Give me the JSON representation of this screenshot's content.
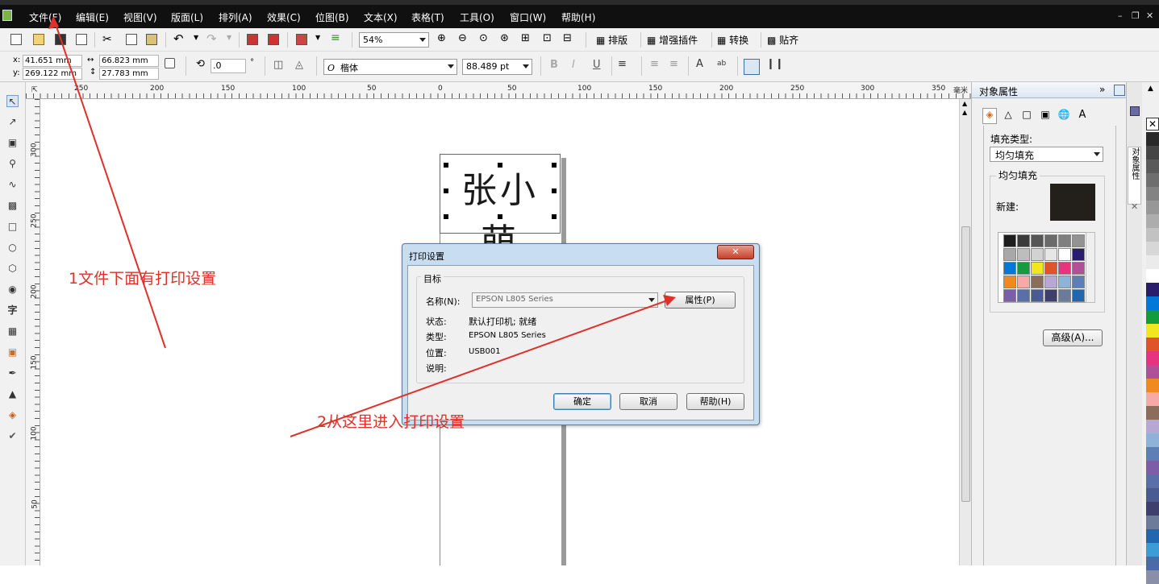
{
  "menu": {
    "items": [
      "文件(F)",
      "编辑(E)",
      "视图(V)",
      "版面(L)",
      "排列(A)",
      "效果(C)",
      "位图(B)",
      "文本(X)",
      "表格(T)",
      "工具(O)",
      "窗口(W)",
      "帮助(H)"
    ]
  },
  "toolbar": {
    "zoom": "54%",
    "typeset_label": "排版",
    "plugins_label": "增强插件",
    "convert_label": "转换",
    "align_label": "贴齐"
  },
  "propbar": {
    "x": "41.651 mm",
    "y": "269.122 mm",
    "width": "66.823 mm",
    "height": "27.783 mm",
    "rotation": ".0",
    "rotation_unit": "°",
    "font": "楷体",
    "font_size": "88.489 pt"
  },
  "ruler": {
    "h_ticks": [
      "250",
      "200",
      "150",
      "100",
      "50",
      "0",
      "50",
      "100",
      "150",
      "200",
      "250",
      "300",
      "350"
    ],
    "h_unit": "毫米",
    "v_ticks": [
      "300",
      "250",
      "200",
      "150",
      "100",
      "50"
    ]
  },
  "canvas": {
    "text_object": "张小萌"
  },
  "docker": {
    "title": "对象属性",
    "fill_type_label": "填充类型:",
    "fill_type_value": "均匀填充",
    "uniform_fill_label": "均匀填充",
    "new_label": "新建:",
    "new_color": "#231f1a",
    "advanced_button": "高级(A)...",
    "tab_vertical": "对象属性"
  },
  "dialog": {
    "title": "打印设置",
    "group_label": "目标",
    "name_label": "名称(N):",
    "printer_name": "EPSON L805 Series",
    "properties_button": "属性(P)",
    "status_label": "状态:",
    "status_value": "默认打印机; 就绪",
    "type_label": "类型:",
    "type_value": "EPSON L805 Series",
    "location_label": "位置:",
    "location_value": "USB001",
    "comment_label": "说明:",
    "ok_button": "确定",
    "cancel_button": "取消",
    "help_button": "帮助(H)"
  },
  "annotations": {
    "note1": "1文件下面有打印设置",
    "note2": "2从这里进入打印设置",
    "color": "#e0302a"
  }
}
